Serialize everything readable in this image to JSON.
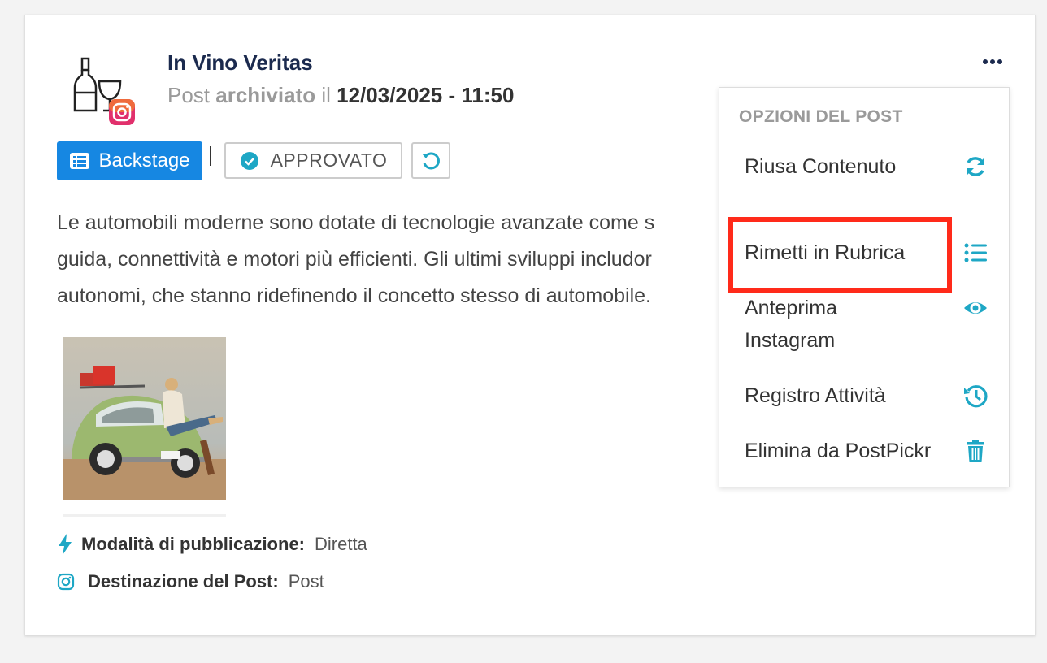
{
  "post": {
    "account_name": "In Vino Veritas",
    "status_prefix": "Post",
    "status_word": "archiviato",
    "status_connector": "il",
    "date": "12/03/2025 - 11:50"
  },
  "badges": {
    "backstage_label": "Backstage",
    "approved_label": "APPROVATO"
  },
  "content": {
    "lines": [
      "Le automobili moderne sono dotate di tecnologie avanzate come s",
      "guida, connettività e motori più efficienti. Gli ultimi sviluppi includor",
      "autonomi, che stanno ridefinendo il concetto stesso di automobile."
    ]
  },
  "meta": {
    "publish_mode_label": "Modalità di pubblicazione:",
    "publish_mode_value": "Diretta",
    "destination_label": "Destinazione del Post:",
    "destination_value": "Post"
  },
  "menu": {
    "header": "OPZIONI DEL POST",
    "items": [
      {
        "label": "Riusa Contenuto",
        "icon": "refresh-icon"
      },
      {
        "label": "Rimetti in Rubrica",
        "icon": "list-icon"
      },
      {
        "label": "Anteprima Instagram",
        "icon": "eye-icon"
      },
      {
        "label": "Registro Attività",
        "icon": "history-icon"
      },
      {
        "label": "Elimina da PostPickr",
        "icon": "trash-icon"
      }
    ]
  },
  "colors": {
    "accent": "#1ea7c5",
    "primary_button": "#1687e2",
    "highlight": "#ff2a1a",
    "title": "#1b2a4e"
  }
}
